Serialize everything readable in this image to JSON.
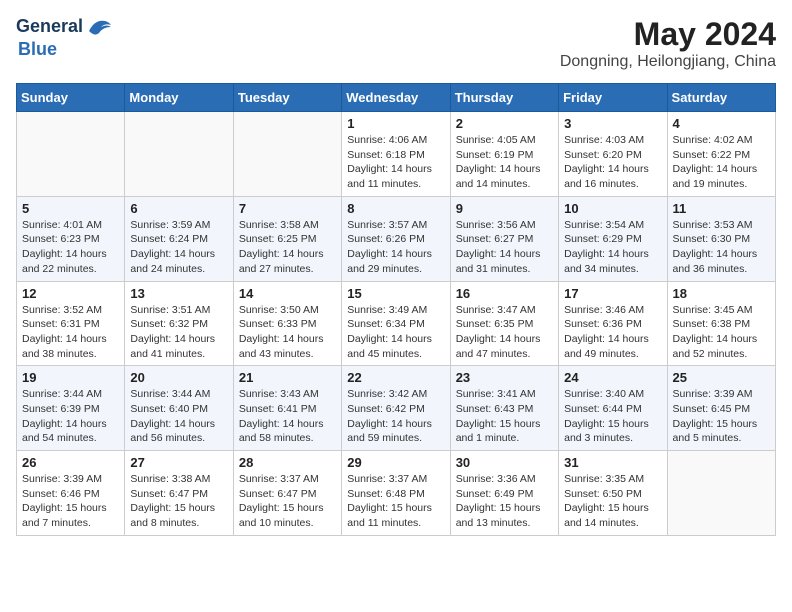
{
  "header": {
    "logo_general": "General",
    "logo_blue": "Blue",
    "month_title": "May 2024",
    "location": "Dongning, Heilongjiang, China"
  },
  "weekdays": [
    "Sunday",
    "Monday",
    "Tuesday",
    "Wednesday",
    "Thursday",
    "Friday",
    "Saturday"
  ],
  "weeks": [
    [
      {
        "day": "",
        "info": ""
      },
      {
        "day": "",
        "info": ""
      },
      {
        "day": "",
        "info": ""
      },
      {
        "day": "1",
        "info": "Sunrise: 4:06 AM\nSunset: 6:18 PM\nDaylight: 14 hours\nand 11 minutes."
      },
      {
        "day": "2",
        "info": "Sunrise: 4:05 AM\nSunset: 6:19 PM\nDaylight: 14 hours\nand 14 minutes."
      },
      {
        "day": "3",
        "info": "Sunrise: 4:03 AM\nSunset: 6:20 PM\nDaylight: 14 hours\nand 16 minutes."
      },
      {
        "day": "4",
        "info": "Sunrise: 4:02 AM\nSunset: 6:22 PM\nDaylight: 14 hours\nand 19 minutes."
      }
    ],
    [
      {
        "day": "5",
        "info": "Sunrise: 4:01 AM\nSunset: 6:23 PM\nDaylight: 14 hours\nand 22 minutes."
      },
      {
        "day": "6",
        "info": "Sunrise: 3:59 AM\nSunset: 6:24 PM\nDaylight: 14 hours\nand 24 minutes."
      },
      {
        "day": "7",
        "info": "Sunrise: 3:58 AM\nSunset: 6:25 PM\nDaylight: 14 hours\nand 27 minutes."
      },
      {
        "day": "8",
        "info": "Sunrise: 3:57 AM\nSunset: 6:26 PM\nDaylight: 14 hours\nand 29 minutes."
      },
      {
        "day": "9",
        "info": "Sunrise: 3:56 AM\nSunset: 6:27 PM\nDaylight: 14 hours\nand 31 minutes."
      },
      {
        "day": "10",
        "info": "Sunrise: 3:54 AM\nSunset: 6:29 PM\nDaylight: 14 hours\nand 34 minutes."
      },
      {
        "day": "11",
        "info": "Sunrise: 3:53 AM\nSunset: 6:30 PM\nDaylight: 14 hours\nand 36 minutes."
      }
    ],
    [
      {
        "day": "12",
        "info": "Sunrise: 3:52 AM\nSunset: 6:31 PM\nDaylight: 14 hours\nand 38 minutes."
      },
      {
        "day": "13",
        "info": "Sunrise: 3:51 AM\nSunset: 6:32 PM\nDaylight: 14 hours\nand 41 minutes."
      },
      {
        "day": "14",
        "info": "Sunrise: 3:50 AM\nSunset: 6:33 PM\nDaylight: 14 hours\nand 43 minutes."
      },
      {
        "day": "15",
        "info": "Sunrise: 3:49 AM\nSunset: 6:34 PM\nDaylight: 14 hours\nand 45 minutes."
      },
      {
        "day": "16",
        "info": "Sunrise: 3:47 AM\nSunset: 6:35 PM\nDaylight: 14 hours\nand 47 minutes."
      },
      {
        "day": "17",
        "info": "Sunrise: 3:46 AM\nSunset: 6:36 PM\nDaylight: 14 hours\nand 49 minutes."
      },
      {
        "day": "18",
        "info": "Sunrise: 3:45 AM\nSunset: 6:38 PM\nDaylight: 14 hours\nand 52 minutes."
      }
    ],
    [
      {
        "day": "19",
        "info": "Sunrise: 3:44 AM\nSunset: 6:39 PM\nDaylight: 14 hours\nand 54 minutes."
      },
      {
        "day": "20",
        "info": "Sunrise: 3:44 AM\nSunset: 6:40 PM\nDaylight: 14 hours\nand 56 minutes."
      },
      {
        "day": "21",
        "info": "Sunrise: 3:43 AM\nSunset: 6:41 PM\nDaylight: 14 hours\nand 58 minutes."
      },
      {
        "day": "22",
        "info": "Sunrise: 3:42 AM\nSunset: 6:42 PM\nDaylight: 14 hours\nand 59 minutes."
      },
      {
        "day": "23",
        "info": "Sunrise: 3:41 AM\nSunset: 6:43 PM\nDaylight: 15 hours\nand 1 minute."
      },
      {
        "day": "24",
        "info": "Sunrise: 3:40 AM\nSunset: 6:44 PM\nDaylight: 15 hours\nand 3 minutes."
      },
      {
        "day": "25",
        "info": "Sunrise: 3:39 AM\nSunset: 6:45 PM\nDaylight: 15 hours\nand 5 minutes."
      }
    ],
    [
      {
        "day": "26",
        "info": "Sunrise: 3:39 AM\nSunset: 6:46 PM\nDaylight: 15 hours\nand 7 minutes."
      },
      {
        "day": "27",
        "info": "Sunrise: 3:38 AM\nSunset: 6:47 PM\nDaylight: 15 hours\nand 8 minutes."
      },
      {
        "day": "28",
        "info": "Sunrise: 3:37 AM\nSunset: 6:47 PM\nDaylight: 15 hours\nand 10 minutes."
      },
      {
        "day": "29",
        "info": "Sunrise: 3:37 AM\nSunset: 6:48 PM\nDaylight: 15 hours\nand 11 minutes."
      },
      {
        "day": "30",
        "info": "Sunrise: 3:36 AM\nSunset: 6:49 PM\nDaylight: 15 hours\nand 13 minutes."
      },
      {
        "day": "31",
        "info": "Sunrise: 3:35 AM\nSunset: 6:50 PM\nDaylight: 15 hours\nand 14 minutes."
      },
      {
        "day": "",
        "info": ""
      }
    ]
  ]
}
